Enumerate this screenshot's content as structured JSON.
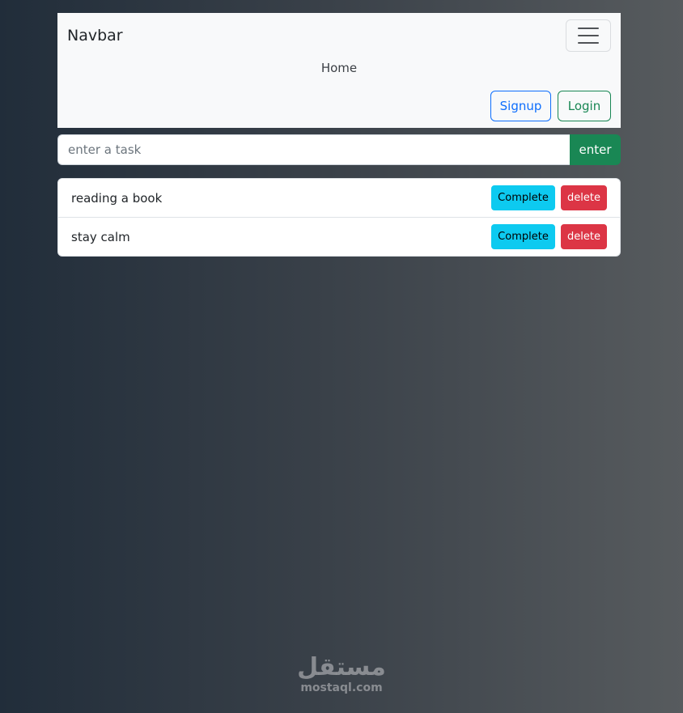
{
  "navbar": {
    "brand": "Navbar",
    "toggler_icon": "hamburger-icon",
    "links": [
      "Home"
    ],
    "signup_label": "Signup",
    "login_label": "Login"
  },
  "task_form": {
    "placeholder": "enter a task",
    "value": "",
    "submit_label": "enter"
  },
  "tasks": [
    {
      "text": "reading a book",
      "complete_label": "Complete",
      "delete_label": "delete"
    },
    {
      "text": "stay calm",
      "complete_label": "Complete",
      "delete_label": "delete"
    }
  ],
  "watermark": {
    "logo_text": "مستقل",
    "url": "mostaql.com"
  },
  "colors": {
    "background_start": "#212d3a",
    "background_end": "#575b5e",
    "navbar_bg": "#f8f9fa",
    "primary": "#0d6efd",
    "success": "#198754",
    "info": "#0dcaf0",
    "danger": "#dc3545"
  }
}
